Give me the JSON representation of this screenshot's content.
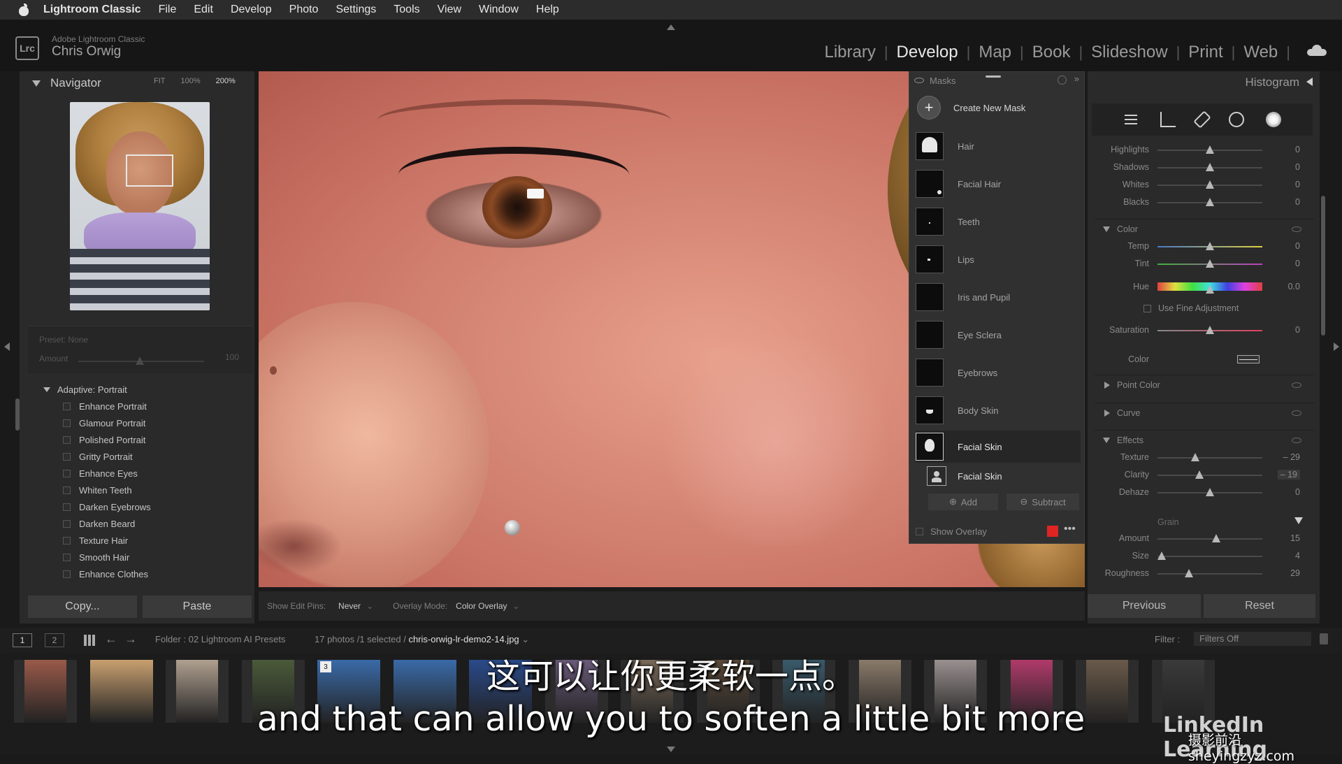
{
  "menubar": {
    "app_name": "Lightroom Classic",
    "items": [
      "File",
      "Edit",
      "Develop",
      "Photo",
      "Settings",
      "Tools",
      "View",
      "Window",
      "Help"
    ]
  },
  "identity": {
    "logo": "Lrc",
    "product": "Adobe Lightroom Classic",
    "user": "Chris Orwig"
  },
  "modules": {
    "items": [
      "Library",
      "Develop",
      "Map",
      "Book",
      "Slideshow",
      "Print",
      "Web"
    ],
    "active": "Develop"
  },
  "navigator": {
    "title": "Navigator",
    "zoom_options": [
      "FIT",
      "100%",
      "200%"
    ],
    "zoom_selected": "200%"
  },
  "preset_amount": {
    "preset_label": "Preset: None",
    "amount_label": "Amount",
    "amount_value": "100"
  },
  "presets": {
    "group": "Adaptive: Portrait",
    "items": [
      "Enhance Portrait",
      "Glamour Portrait",
      "Polished Portrait",
      "Gritty Portrait",
      "Enhance Eyes",
      "Whiten Teeth",
      "Darken Eyebrows",
      "Darken Beard",
      "Texture Hair",
      "Smooth Hair",
      "Enhance Clothes"
    ]
  },
  "left_buttons": {
    "copy": "Copy...",
    "paste": "Paste"
  },
  "toolbar": {
    "edit_pins_label": "Show Edit Pins:",
    "edit_pins_value": "Never",
    "overlay_mode_label": "Overlay Mode:",
    "overlay_mode_value": "Color Overlay"
  },
  "masks": {
    "title": "Masks",
    "create_label": "Create New Mask",
    "items": [
      "Hair",
      "Facial Hair",
      "Teeth",
      "Lips",
      "Iris and Pupil",
      "Eye Sclera",
      "Eyebrows",
      "Body Skin",
      "Facial Skin"
    ],
    "selected": "Facial Skin",
    "sub_item": "Facial Skin",
    "add_label": "Add",
    "subtract_label": "Subtract",
    "show_overlay_label": "Show Overlay",
    "overlay_color": "#e02424",
    "more_icon": "•••"
  },
  "right_panel": {
    "histogram_label": "Histogram",
    "tone_sliders": [
      {
        "name": "Highlights",
        "value": "0",
        "level": 0.5
      },
      {
        "name": "Shadows",
        "value": "0",
        "level": 0.5
      },
      {
        "name": "Whites",
        "value": "0",
        "level": 0.5
      },
      {
        "name": "Blacks",
        "value": "0",
        "level": 0.5
      }
    ],
    "color_section": "Color",
    "color_sliders": [
      {
        "name": "Temp",
        "value": "0",
        "level": 0.5
      },
      {
        "name": "Tint",
        "value": "0",
        "level": 0.5
      },
      {
        "name": "Hue",
        "value": "0.0",
        "level": 0.5
      }
    ],
    "fine_adjustment_label": "Use Fine Adjustment",
    "saturation": {
      "name": "Saturation",
      "value": "0",
      "level": 0.5
    },
    "color_label": "Color",
    "point_color_section": "Point Color",
    "curve_section": "Curve",
    "effects_section": "Effects",
    "effects_sliders": [
      {
        "name": "Texture",
        "value": "– 29",
        "level": 0.36
      },
      {
        "name": "Clarity",
        "value": "– 19",
        "level": 0.4
      },
      {
        "name": "Dehaze",
        "value": "0",
        "level": 0.5
      }
    ],
    "grain_label": "Grain",
    "grain_sliders": [
      {
        "name": "Amount",
        "value": "15",
        "level": 0.56
      },
      {
        "name": "Size",
        "value": "4",
        "level": 0.04
      },
      {
        "name": "Roughness",
        "value": "29",
        "level": 0.3
      }
    ],
    "previous_label": "Previous",
    "reset_label": "Reset"
  },
  "filmstrip_bar": {
    "screen1": "1",
    "screen2": "2",
    "folder": "Folder : 02 Lightroom AI Presets",
    "count_prefix": "17 photos /1 selected /",
    "filename": "chris-orwig-lr-demo2-14.jpg",
    "filter_label": "Filter :",
    "filter_value": "Filters Off"
  },
  "filmstrip": {
    "stack_badge": "3",
    "thumbs": [
      "#9a5a4a",
      "#c8a070",
      "#b0a090",
      "#4a5a3a",
      "#3a6aa8",
      "#3a6aa8",
      "#2a4a8a",
      "#6a5a7a",
      "#7a6a5a",
      "#5a4a3a",
      "#3a5a6a",
      "#8a7a6a",
      "#9a9090",
      "#b03a6a",
      "#6a5a4a",
      "#3a3a3a"
    ]
  },
  "subtitles": {
    "chinese": "这可以让你更柔软一点。",
    "english": "and that can allow you to soften a little bit more"
  },
  "watermarks": {
    "linkedin": "LinkedIn Learning",
    "site": "摄影前沿sheyingzyz.com"
  }
}
